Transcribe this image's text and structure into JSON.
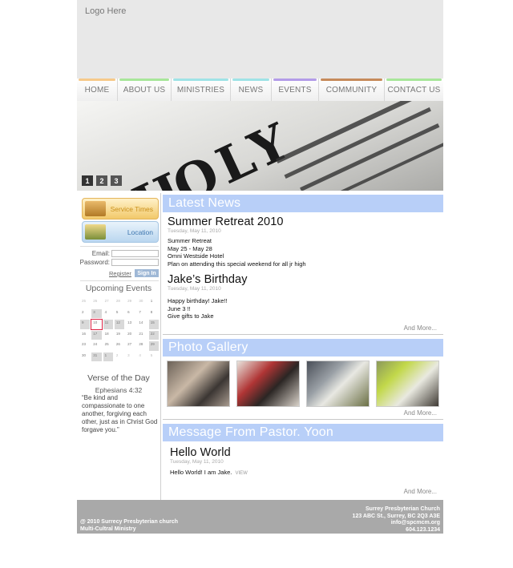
{
  "header": {
    "logo_text": "Logo Here"
  },
  "nav": [
    {
      "label": "HOME",
      "color": "#f6c98a"
    },
    {
      "label": "ABOUT US",
      "color": "#a8e69a"
    },
    {
      "label": "MINISTRIES",
      "color": "#9fe3e6"
    },
    {
      "label": "NEWS",
      "color": "#9fe3e6"
    },
    {
      "label": "EVENTS",
      "color": "#b39ce8"
    },
    {
      "label": "COMMUNITY",
      "color": "#c68a5a"
    },
    {
      "label": "CONTACT US",
      "color": "#a8e69a"
    }
  ],
  "hero": {
    "slides": [
      "1",
      "2",
      "3"
    ],
    "active_slide": 1
  },
  "sidebar": {
    "service_times": "Service Times",
    "location": "Location",
    "login": {
      "email_label": "Email:",
      "password_label": "Password:",
      "register": "Register",
      "sign_in": "Sign In"
    },
    "upcoming_title": "Upcoming Events",
    "calendar": {
      "days": [
        "25",
        "26",
        "27",
        "28",
        "29",
        "30",
        "1",
        "2",
        "3",
        "4",
        "5",
        "6",
        "7",
        "8",
        "9",
        "10",
        "11",
        "12",
        "13",
        "14",
        "15",
        "16",
        "17",
        "18",
        "19",
        "20",
        "21",
        "22",
        "23",
        "24",
        "25",
        "26",
        "27",
        "28",
        "29",
        "30",
        "31",
        "1",
        "2",
        "3",
        "4",
        "5"
      ],
      "today": "10"
    },
    "verse_title": "Verse of the Day",
    "verse_ref": "Ephesians 4:32",
    "verse_text": "“Be kind and compassionate to one another, forgiving each other, just as in Christ God forgave you.”"
  },
  "news": {
    "heading": "Latest News",
    "articles": [
      {
        "title": "Summer Retreat 2010",
        "date": "Tuesday, May 11, 2010",
        "lines": [
          "Summer Retreat",
          "May 25 - May 28",
          "Omni Westside Hotel",
          "Plan on attending this special weekend for all jr high"
        ]
      },
      {
        "title": "Jake’s Birthday",
        "date": "Tuesday, May 11, 2010",
        "lines": [
          "Happy birthday! Jake!!",
          "June 3 !!",
          "Give gifts to Jake"
        ]
      }
    ],
    "more": "And More..."
  },
  "gallery": {
    "heading": "Photo Gallery",
    "more": "And More..."
  },
  "pastor": {
    "heading": "Message From Pastor. Yoon",
    "title": "Hello World",
    "date": "Tuesday, May 11, 2010",
    "body": "Hello World! I am Jake.",
    "view": "VIEW",
    "more": "And More..."
  },
  "footer": {
    "left": [
      "@ 2010 Surrecy Presbyterian church",
      "Multi-Cultral Ministry"
    ],
    "right": [
      "Surrey Presbyterian Church",
      "123 ABC St., Surrey, BC 2Q3 A3E",
      "info@spcmcm.org",
      "604.123.1234"
    ]
  }
}
